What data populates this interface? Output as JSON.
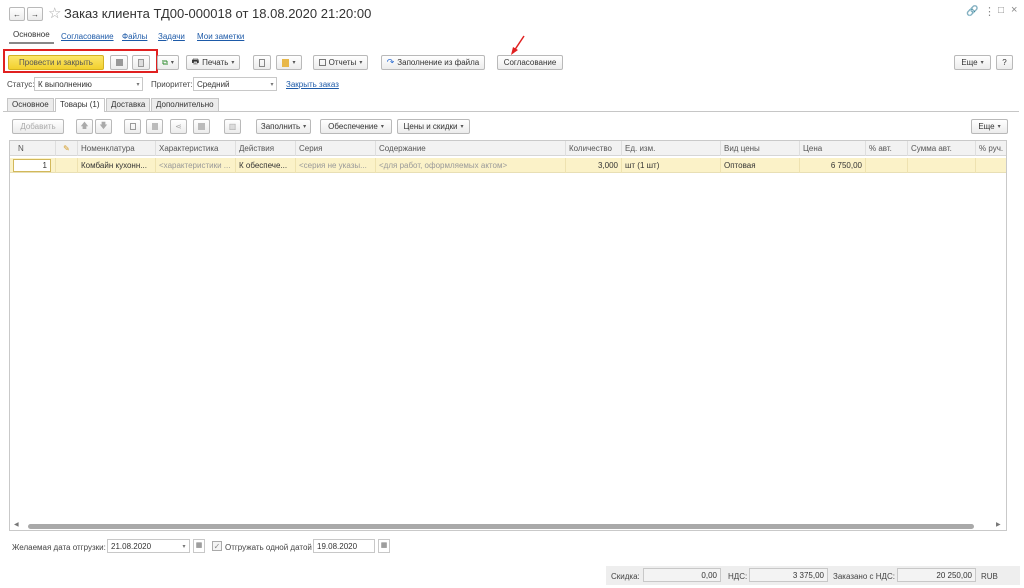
{
  "window": {
    "title": "Заказ клиента ТД00-000018 от 18.08.2020 21:20:00"
  },
  "nav_tabs": [
    {
      "label": "Основное"
    },
    {
      "label": "Согласование"
    },
    {
      "label": "Файлы"
    },
    {
      "label": "Задачи"
    },
    {
      "label": "Мои заметки"
    }
  ],
  "toolbar": {
    "post_close_label": "Провести и закрыть",
    "print_label": "Печать",
    "reports_label": "Отчеты",
    "fill_from_file_label": "Заполнение из файла",
    "approval_label": "Согласование",
    "more_label": "Еще",
    "help_label": "?"
  },
  "status_row": {
    "status_label": "Статус:",
    "status_value": "К выполнению",
    "priority_label": "Приоритет:",
    "priority_value": "Средний",
    "close_order_link": "Закрыть заказ"
  },
  "inner_tabs": [
    {
      "label": "Основное"
    },
    {
      "label": "Товары (1)"
    },
    {
      "label": "Доставка"
    },
    {
      "label": "Дополнительно"
    }
  ],
  "table_toolbar": {
    "add_label": "Добавить",
    "fill_label": "Заполнить",
    "supply_label": "Обеспечение",
    "prices_label": "Цены и скидки",
    "more_label": "Еще"
  },
  "table": {
    "headers": [
      "N",
      "",
      "Номенклатура",
      "Характеристика",
      "Действия",
      "Серия",
      "Содержание",
      "Количество",
      "Ед. изм.",
      "Вид цены",
      "Цена",
      "% авт.",
      "Сумма авт.",
      "% руч."
    ],
    "rows": [
      {
        "n": "1",
        "nomenclature": "Комбайн кухонн...",
        "characteristic": "<характеристики ...",
        "actions": "К обеспече...",
        "series": "<серия не указы...",
        "content": "<для работ, оформляемых актом>",
        "quantity": "3,000",
        "unit": "шт (1 шт)",
        "price_type": "Оптовая",
        "price": "6 750,00"
      }
    ]
  },
  "bottom": {
    "desired_date_label": "Желаемая дата отгрузки:",
    "desired_date_value": "21.08.2020",
    "ship_one_date_label": "Отгружать одной датой",
    "ship_one_date_value": "19.08.2020"
  },
  "totals": {
    "discount_label": "Скидка:",
    "discount_value": "0,00",
    "vat_label": "НДС:",
    "vat_value": "3 375,00",
    "ordered_label": "Заказано с НДС:",
    "ordered_value": "20 250,00",
    "currency": "RUB"
  },
  "colors": {
    "primary_button": "#f5d93e",
    "link": "#1d5aa8",
    "selected_row": "#fbf2c8",
    "highlight_box": "#e02020"
  }
}
